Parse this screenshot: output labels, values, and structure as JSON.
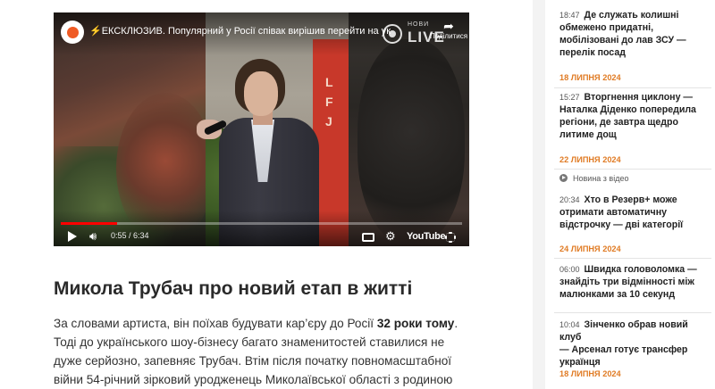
{
  "video": {
    "title": "⚡ЕКСКЛЮЗИВ. Популярний у Росії співак вирішив перейти на ук",
    "brand_small": "НОВИ",
    "brand_big": "LIVE",
    "share_label": "Поділитися",
    "current_time": "0:55 / 6:34",
    "progress_fraction": 0.14,
    "youtube_label": "YouTube",
    "banner_letters": [
      "L",
      "F",
      "J"
    ]
  },
  "article": {
    "headline": "Микола Трубач про новий етап в житті",
    "para_part1": "За словами артиста, він поїхав будувати кар’єру до Росії ",
    "para_bold": "32 роки тому",
    "para_part2": ". Тоді до українського шоу-бізнесу багато знаменитостей ставилися не дуже серйозно, запевняє Трубач. Втім після початку повномасштабної війни 54-річний зірковий уродженець Миколаївської області з родиною виїхав з РФ."
  },
  "sidebar": {
    "items": [
      {
        "time": "18:47",
        "lines": [
          "Де служать колишні",
          "обмежено придатні,",
          "мобілізовані до лав ЗСУ —",
          "перелік посад"
        ]
      },
      {
        "date": "18 ЛИПНЯ 2024"
      },
      {
        "time": "15:27",
        "lines": [
          "Вторгнення циклону —",
          "Наталка Діденко попередила",
          "регіони, де завтра щедро",
          "литиме дощ"
        ]
      },
      {
        "date": "22 ЛИПНЯ 2024"
      },
      {
        "tag": "Новина з відео"
      },
      {
        "time": "20:34",
        "lines": [
          "Хто в Резерв+ може",
          "отримати автоматичну",
          "відстрочку — дві категорії"
        ]
      },
      {
        "date": "24 ЛИПНЯ 2024"
      },
      {
        "time": "06:00",
        "lines": [
          "Швидка головоломка —",
          "знайдіть три відмінності між",
          "малюнками за 10 секунд"
        ]
      },
      {
        "time": "10:04",
        "lines": [
          "Зінченко обрав новий клуб",
          "— Арсенал готує трансфер",
          "українця"
        ]
      },
      {
        "date": "18 ЛИПНЯ 2024"
      }
    ]
  },
  "colors": {
    "accent_date": "#e07b24",
    "progress": "#ff0000",
    "channel_logo": "#ef5a24"
  }
}
